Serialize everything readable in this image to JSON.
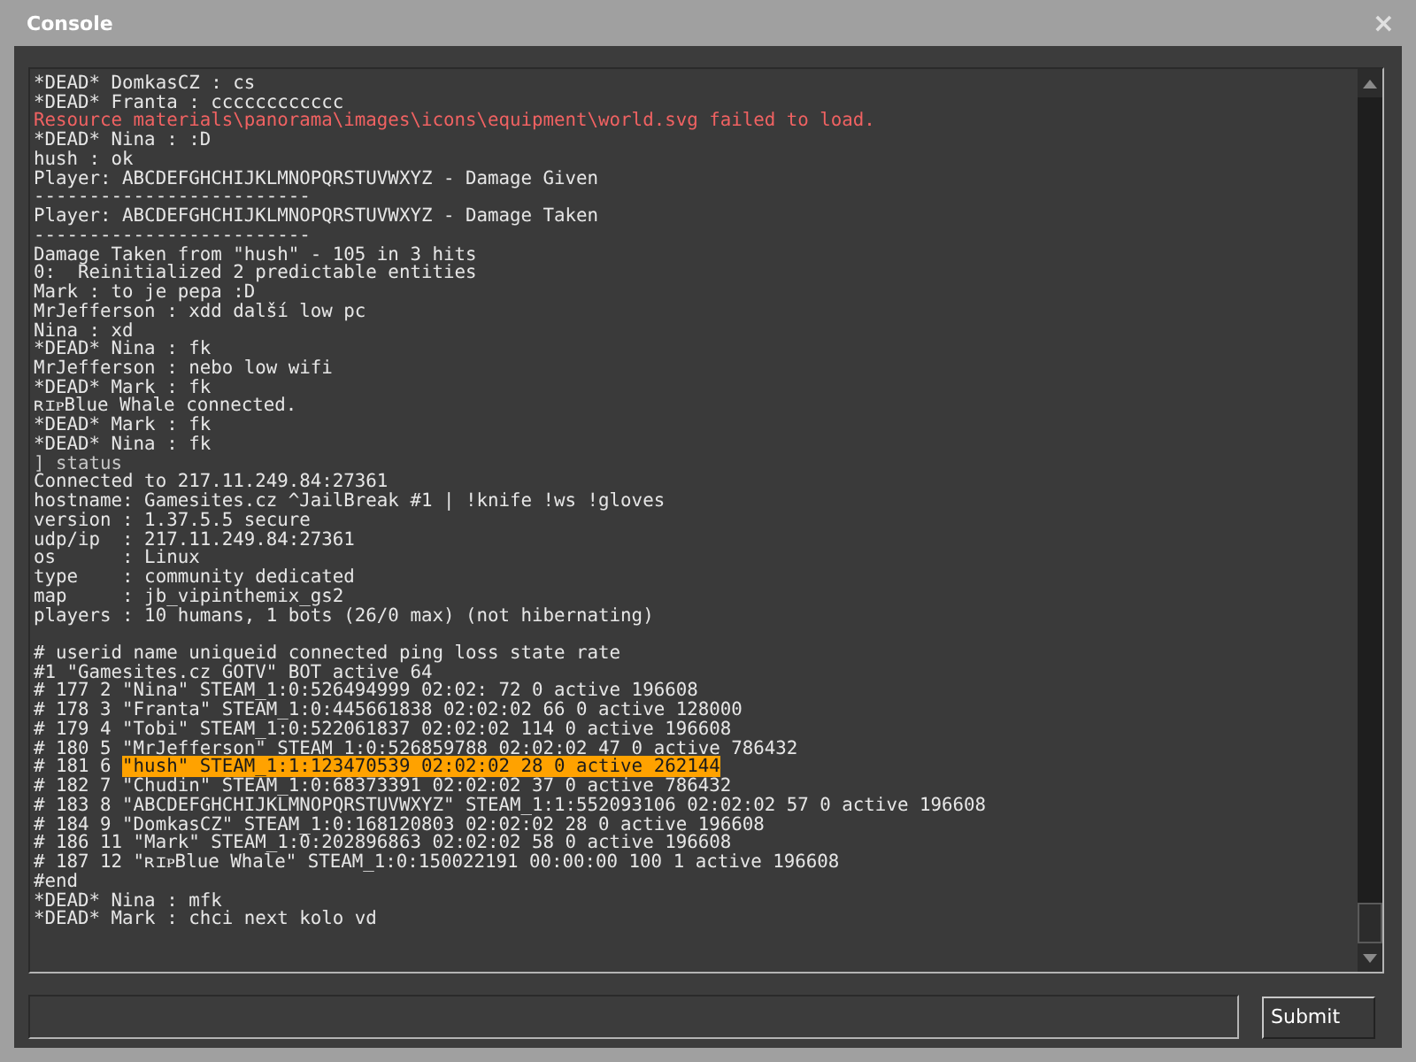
{
  "window": {
    "title": "Console",
    "close": "×"
  },
  "console": {
    "lines": [
      {
        "kind": "normal",
        "text": "*DEAD* DomkasCZ : cs"
      },
      {
        "kind": "normal",
        "text": "*DEAD* Franta : cccccccccccc"
      },
      {
        "kind": "error",
        "text": "Resource materials\\panorama\\images\\icons\\equipment\\world.svg failed to load."
      },
      {
        "kind": "normal",
        "text": "*DEAD* Nina : :D"
      },
      {
        "kind": "normal",
        "text": "hush : ok"
      },
      {
        "kind": "normal",
        "text": "Player: ABCDEFGHCHIJKLMNOPQRSTUVWXYZ - Damage Given"
      },
      {
        "kind": "normal",
        "text": "-------------------------"
      },
      {
        "kind": "normal",
        "text": "Player: ABCDEFGHCHIJKLMNOPQRSTUVWXYZ - Damage Taken"
      },
      {
        "kind": "normal",
        "text": "-------------------------"
      },
      {
        "kind": "normal",
        "text": "Damage Taken from \"hush\" - 105 in 3 hits"
      },
      {
        "kind": "normal",
        "text": "0:  Reinitialized 2 predictable entities"
      },
      {
        "kind": "normal",
        "text": "Mark : to je pepa :D"
      },
      {
        "kind": "normal",
        "text": "MrJefferson : xdd další low pc"
      },
      {
        "kind": "normal",
        "text": "Nina : xd"
      },
      {
        "kind": "normal",
        "text": "*DEAD* Nina : fk"
      },
      {
        "kind": "normal",
        "text": "MrJefferson : nebo low wifi"
      },
      {
        "kind": "normal",
        "text": "*DEAD* Mark : fk"
      },
      {
        "kind": "normal",
        "text": "ʀɪᴘBlue Whale connected."
      },
      {
        "kind": "normal",
        "text": "*DEAD* Mark : fk"
      },
      {
        "kind": "normal",
        "text": "*DEAD* Nina : fk"
      },
      {
        "kind": "command",
        "text": "] status"
      },
      {
        "kind": "normal",
        "text": "Connected to 217.11.249.84:27361"
      },
      {
        "kind": "normal",
        "text": "hostname: Gamesites.cz ^JailBreak #1 | !knife !ws !gloves"
      },
      {
        "kind": "normal",
        "text": "version : 1.37.5.5 secure"
      },
      {
        "kind": "normal",
        "text": "udp/ip  : 217.11.249.84:27361"
      },
      {
        "kind": "normal",
        "text": "os      : Linux"
      },
      {
        "kind": "normal",
        "text": "type    : community dedicated"
      },
      {
        "kind": "normal",
        "text": "map     : jb_vipinthemix_gs2"
      },
      {
        "kind": "normal",
        "text": "players : 10 humans, 1 bots (26/0 max) (not hibernating)"
      },
      {
        "kind": "blank"
      },
      {
        "kind": "normal",
        "text": "# userid name uniqueid connected ping loss state rate"
      },
      {
        "kind": "normal",
        "text": "#1 \"Gamesites.cz GOTV\" BOT active 64"
      },
      {
        "kind": "normal",
        "text": "# 177 2 \"Nina\" STEAM_1:0:526494999 02:02: 72 0 active 196608"
      },
      {
        "kind": "normal",
        "text": "# 178 3 \"Franta\" STEAM_1:0:445661838 02:02:02 66 0 active 128000"
      },
      {
        "kind": "normal",
        "text": "# 179 4 \"Tobi\" STEAM_1:0:522061837 02:02:02 114 0 active 196608"
      },
      {
        "kind": "normal",
        "text": "# 180 5 \"MrJefferson\" STEAM_1:0:526859788 02:02:02 47 0 active 786432"
      },
      {
        "kind": "highlight",
        "prefix": "# 181 6 ",
        "text": "\"hush\" STEAM_1:1:123470539 02:02:02 28 0 active 262144"
      },
      {
        "kind": "normal",
        "text": "# 182 7 \"Chudin\" STEAM_1:0:68373391 02:02:02 37 0 active 786432"
      },
      {
        "kind": "normal",
        "text": "# 183 8 \"ABCDEFGHCHIJKLMNOPQRSTUVWXYZ\" STEAM_1:1:552093106 02:02:02 57 0 active 196608"
      },
      {
        "kind": "normal",
        "text": "# 184 9 \"DomkasCZ\" STEAM_1:0:168120803 02:02:02 28 0 active 196608"
      },
      {
        "kind": "normal",
        "text": "# 186 11 \"Mark\" STEAM_1:0:202896863 02:02:02 58 0 active 196608"
      },
      {
        "kind": "normal",
        "text": "# 187 12 \"ʀɪᴘBlue Whale\" STEAM_1:0:150022191 00:00:00 100 1 active 196608"
      },
      {
        "kind": "normal",
        "text": "#end"
      },
      {
        "kind": "normal",
        "text": "*DEAD* Nina : mfk"
      },
      {
        "kind": "normal",
        "text": "*DEAD* Mark : chci next kolo vd"
      }
    ]
  },
  "input": {
    "submit": "Submit"
  }
}
